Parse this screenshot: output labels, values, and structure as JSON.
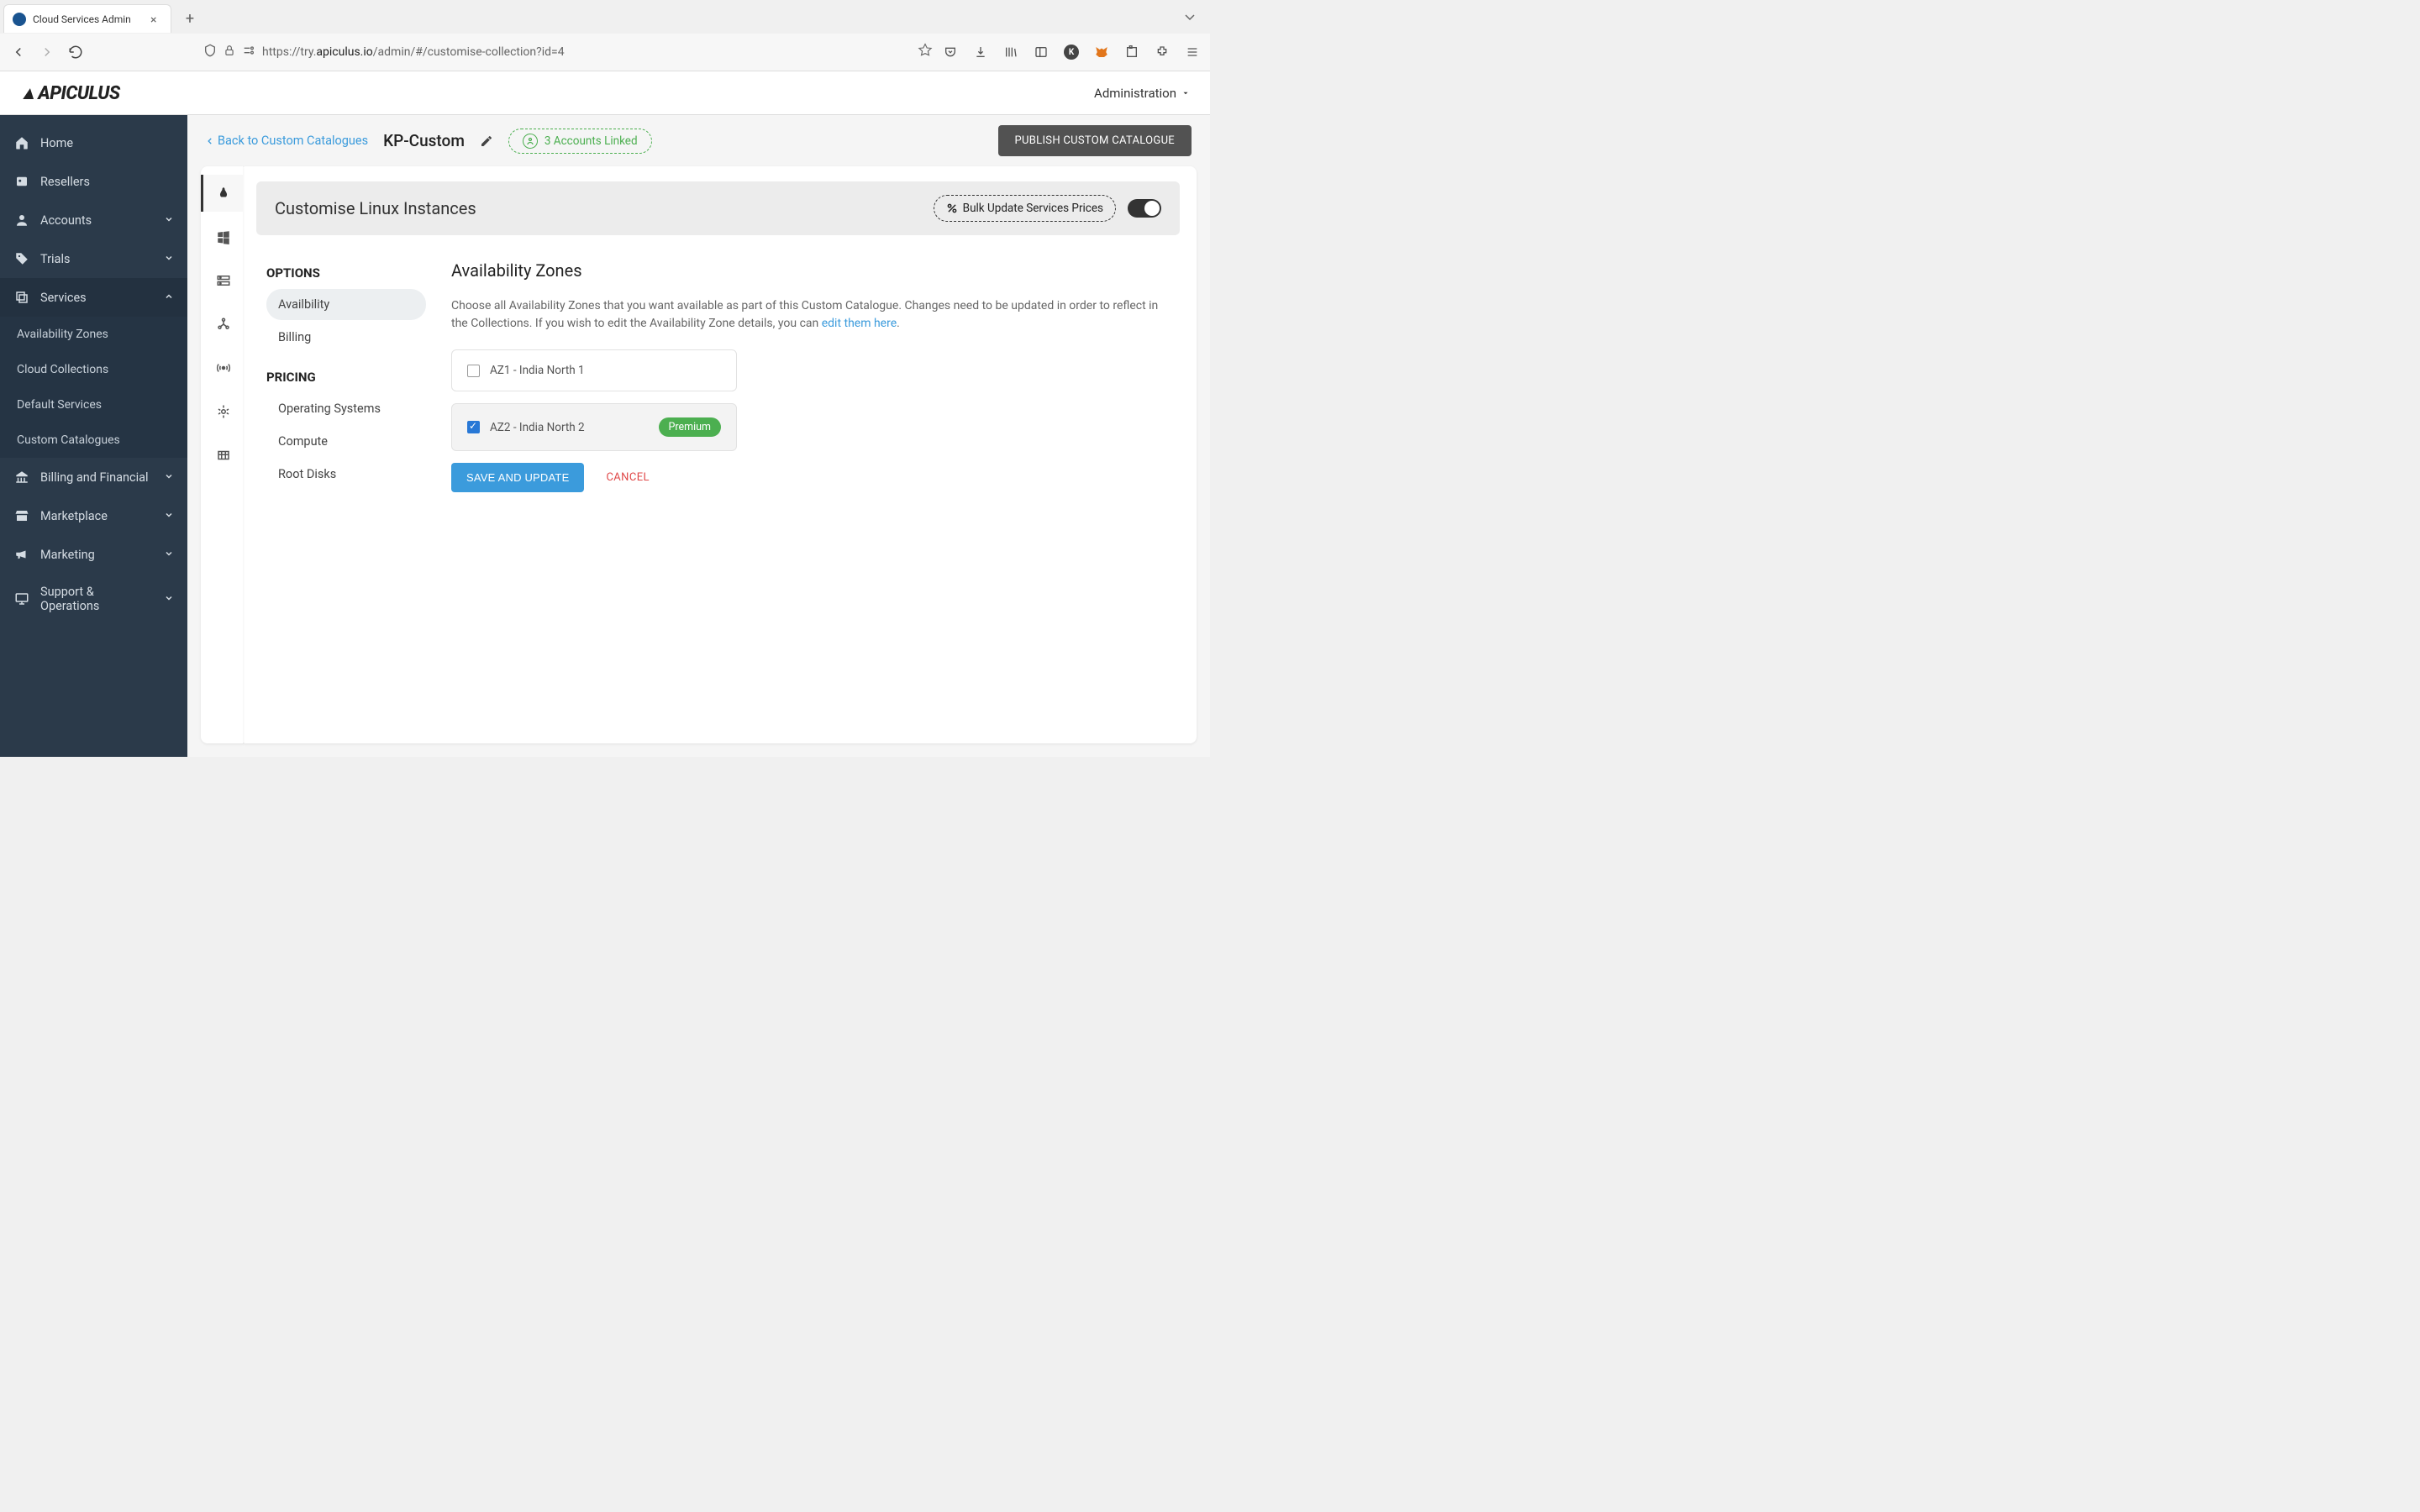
{
  "browser": {
    "tab_title": "Cloud Services Admin",
    "url_prefix": "https://try.",
    "url_domain": "apiculus.io",
    "url_path": "/admin/#/customise-collection?id=4"
  },
  "header": {
    "logo_text": "APICULUS",
    "admin_label": "Administration"
  },
  "sidebar": {
    "items": [
      {
        "label": "Home",
        "icon": "home"
      },
      {
        "label": "Resellers",
        "icon": "badge"
      },
      {
        "label": "Accounts",
        "icon": "user",
        "chevron": true
      },
      {
        "label": "Trials",
        "icon": "tag",
        "chevron": true
      },
      {
        "label": "Services",
        "icon": "layers",
        "chevron": true,
        "expanded": true,
        "subs": [
          {
            "label": "Availability Zones"
          },
          {
            "label": "Cloud Collections"
          },
          {
            "label": "Default Services"
          },
          {
            "label": "Custom Catalogues",
            "active": true
          }
        ]
      },
      {
        "label": "Billing and Financial",
        "icon": "bank",
        "chevron": true
      },
      {
        "label": "Marketplace",
        "icon": "store",
        "chevron": true
      },
      {
        "label": "Marketing",
        "icon": "megaphone",
        "chevron": true
      },
      {
        "label": "Support & Operations",
        "icon": "monitor",
        "chevron": true
      }
    ]
  },
  "content_header": {
    "back_label": "Back to Custom Catalogues",
    "catalogue_name": "KP-Custom",
    "accounts_linked": "3 Accounts Linked",
    "publish_label": "PUBLISH CUSTOM CATALOGUE"
  },
  "panel": {
    "title": "Customise Linux Instances",
    "bulk_label": "Bulk Update Services Prices"
  },
  "options": {
    "heading1": "OPTIONS",
    "items1": [
      {
        "label": "Availbility",
        "active": true
      },
      {
        "label": "Billing"
      }
    ],
    "heading2": "PRICING",
    "items2": [
      {
        "label": "Operating Systems"
      },
      {
        "label": "Compute"
      },
      {
        "label": "Root Disks"
      }
    ]
  },
  "az_section": {
    "title": "Availability Zones",
    "desc_pre": "Choose all Availability Zones that you want available as part of this Custom Catalogue. Changes need to be updated in order to reflect in the Collections. If you wish to edit the Availability Zone details, you can ",
    "desc_link": "edit them here",
    "desc_post": ".",
    "zones": [
      {
        "label": "AZ1 - India North 1",
        "checked": false
      },
      {
        "label": "AZ2 - India North 2",
        "checked": true,
        "badge": "Premium"
      }
    ],
    "save_label": "SAVE AND UPDATE",
    "cancel_label": "CANCEL"
  }
}
